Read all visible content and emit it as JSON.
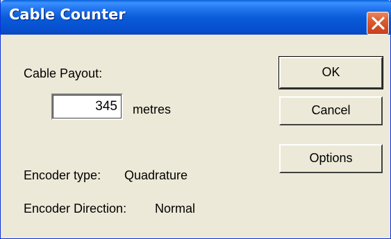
{
  "window": {
    "title": "Cable Counter",
    "close_icon": "close-x-icon"
  },
  "payout": {
    "label": "Cable Payout:",
    "value": "345",
    "unit": "metres"
  },
  "encoder": {
    "type_label": "Encoder type:",
    "type_value": "Quadrature",
    "direction_label": "Encoder Direction:",
    "direction_value": "Normal"
  },
  "buttons": {
    "ok": "OK",
    "cancel": "Cancel",
    "options": "Options"
  },
  "colors": {
    "titlebar": "#0a5cd8",
    "close_button": "#dd5a2e",
    "dialog_background": "#ece9d8"
  }
}
